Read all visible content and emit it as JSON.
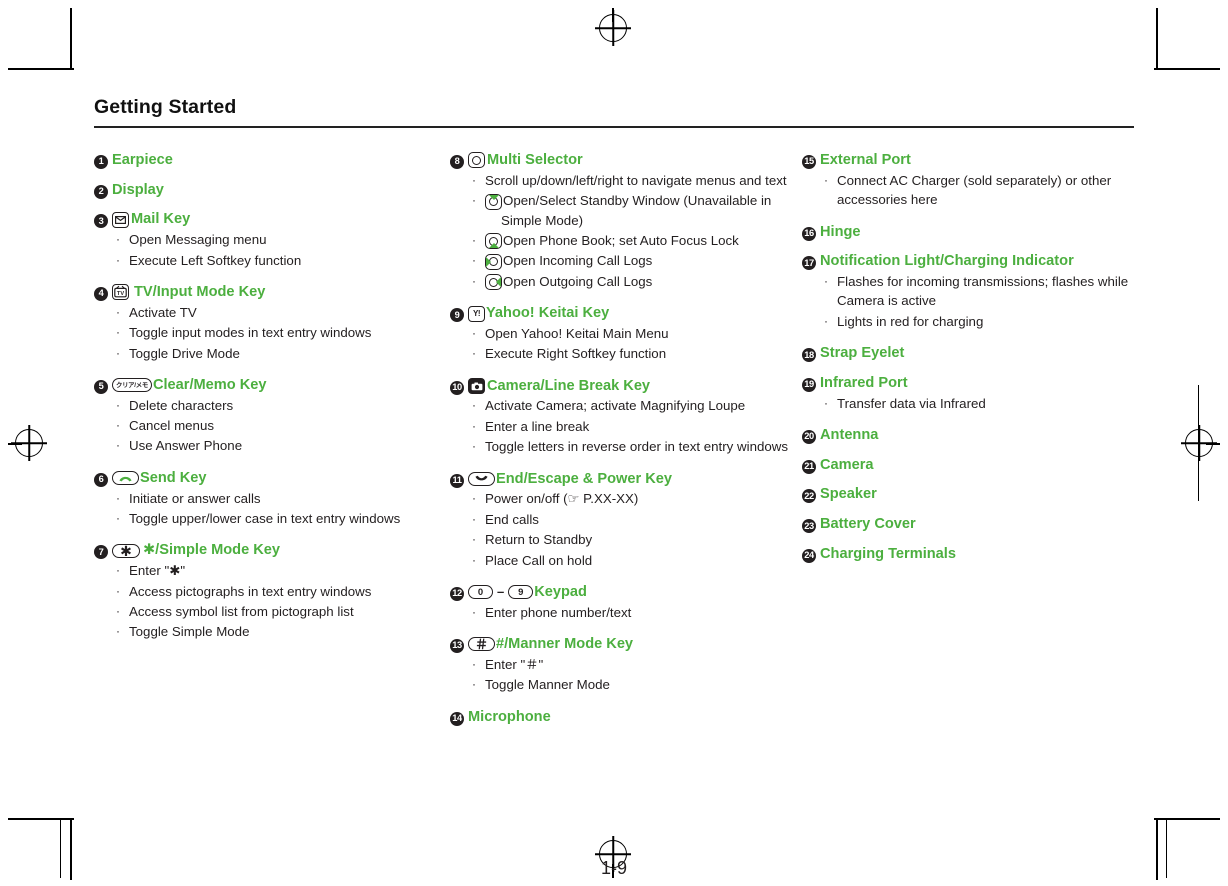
{
  "page": {
    "title": "Getting Started",
    "page_number": "1-9"
  },
  "columns": [
    {
      "id": "column-left",
      "entries": [
        {
          "num": "❶",
          "num_text": "1",
          "label": "Earpiece",
          "icon": null,
          "bullets": []
        },
        {
          "num": "❷",
          "num_text": "2",
          "label": "Display",
          "icon": null,
          "bullets": []
        },
        {
          "num": "❸",
          "num_text": "3",
          "label": "Mail Key",
          "icon": "mail-key-icon",
          "bullets": [
            "Open Messaging menu",
            "Execute Left Softkey function"
          ]
        },
        {
          "num": "❹",
          "num_text": "4",
          "label": "TV/Input Mode Key",
          "icon": "tv-key-icon",
          "bullets": [
            "Activate TV",
            "Toggle input modes in text entry windows",
            "Toggle Drive Mode"
          ]
        },
        {
          "num": "❺",
          "num_text": "5",
          "label": "Clear/Memo Key",
          "icon": "clear-memo-key-icon",
          "bullets": [
            "Delete characters",
            "Cancel menus",
            "Use Answer Phone"
          ]
        },
        {
          "num": "❻",
          "num_text": "6",
          "label": "Send Key",
          "icon": "send-key-icon",
          "bullets": [
            "Initiate or answer calls",
            "Toggle upper/lower case in text entry windows"
          ]
        },
        {
          "num": "❼",
          "num_text": "7",
          "label": "/Simple Mode Key",
          "icon": "star-key-icon",
          "bullets": [
            "Enter \"✱\"",
            "Access pictographs in text entry windows",
            "Access symbol list from pictograph list",
            "Toggle Simple Mode"
          ]
        }
      ]
    },
    {
      "id": "column-middle",
      "entries": [
        {
          "num": "❽",
          "num_text": "8",
          "label": "Multi Selector",
          "icon": "multi-selector-icon",
          "bullets": [
            "Scroll up/down/left/right to navigate menus and text",
            "Open/Select Standby Window (Unavailable in Simple Mode)",
            "Open Phone Book; set Auto Focus Lock",
            "Open Incoming Call Logs",
            "Open Outgoing Call Logs"
          ]
        },
        {
          "num": "❾",
          "num_text": "9",
          "label": "Yahoo! Keitai Key",
          "icon": "yahoo-keitai-key-icon",
          "bullets": [
            "Open Yahoo! Keitai Main Menu",
            "Execute Right Softkey function"
          ]
        },
        {
          "num": "❿",
          "num_text": "10",
          "label": "Camera/Line Break Key",
          "icon": "camera-key-icon",
          "bullets": [
            "Activate Camera; activate Magnifying Loupe",
            "Enter a line break",
            "Toggle letters in reverse order in text entry windows"
          ]
        },
        {
          "num": "⓫",
          "num_text": "11",
          "label": "End/Escape & Power Key",
          "icon": "end-power-key-icon",
          "bullets": [
            "Power on/off (☞ P.XX-XX)",
            "End calls",
            "Return to Standby",
            "Place Call on hold"
          ]
        },
        {
          "num": "⓬",
          "num_text": "12",
          "label": "Keypad",
          "icon": "keypad-range-icon",
          "bullets": [
            "Enter phone number/text"
          ]
        },
        {
          "num": "⓭",
          "num_text": "13",
          "label": "#/Manner Mode Key",
          "icon": "hash-key-icon",
          "bullets": [
            "Enter \"＃\"",
            "Toggle Manner Mode"
          ]
        },
        {
          "num": "⓮",
          "num_text": "14",
          "label": "Microphone",
          "icon": null,
          "bullets": []
        }
      ]
    },
    {
      "id": "column-right",
      "entries": [
        {
          "num": "⓯",
          "num_text": "15",
          "label": "External Port",
          "icon": null,
          "bullets": [
            "Connect AC Charger (sold separately) or other accessories here"
          ]
        },
        {
          "num": "⓰",
          "num_text": "16",
          "label": "Hinge",
          "icon": null,
          "bullets": []
        },
        {
          "num": "⓱",
          "num_text": "17",
          "label": "Notification Light/Charging Indicator",
          "icon": null,
          "bullets": [
            "Flashes for incoming transmissions; flashes while Camera is active",
            "Lights in red for charging"
          ]
        },
        {
          "num": "⓲",
          "num_text": "18",
          "label": "Strap Eyelet",
          "icon": null,
          "bullets": []
        },
        {
          "num": "⓳",
          "num_text": "19",
          "label": "Infrared Port",
          "icon": null,
          "bullets": [
            "Transfer data via Infrared"
          ]
        },
        {
          "num": "⓴",
          "num_text": "20",
          "label": "Antenna",
          "icon": null,
          "bullets": []
        },
        {
          "num": "⓵",
          "num_text": "21",
          "label": "Camera",
          "icon": null,
          "bullets": []
        },
        {
          "num": "⓶",
          "num_text": "22",
          "label": "Speaker",
          "icon": null,
          "bullets": []
        },
        {
          "num": "⓷",
          "num_text": "23",
          "label": "Battery Cover",
          "icon": null,
          "bullets": []
        },
        {
          "num": "⓸",
          "num_text": "24",
          "label": "Charging Terminals",
          "icon": null,
          "bullets": []
        }
      ]
    }
  ],
  "icon_labels": {
    "clear_memo_jp": "クリア/メモ",
    "tv": "TV",
    "yahoo": "Y!",
    "star": "✱",
    "hash": "＃",
    "key_zero": "0",
    "key_nine": "9",
    "dash": "–"
  },
  "colors": {
    "heading_green": "#4CAF3F",
    "text_black": "#231f20",
    "bullet_char": "·"
  }
}
